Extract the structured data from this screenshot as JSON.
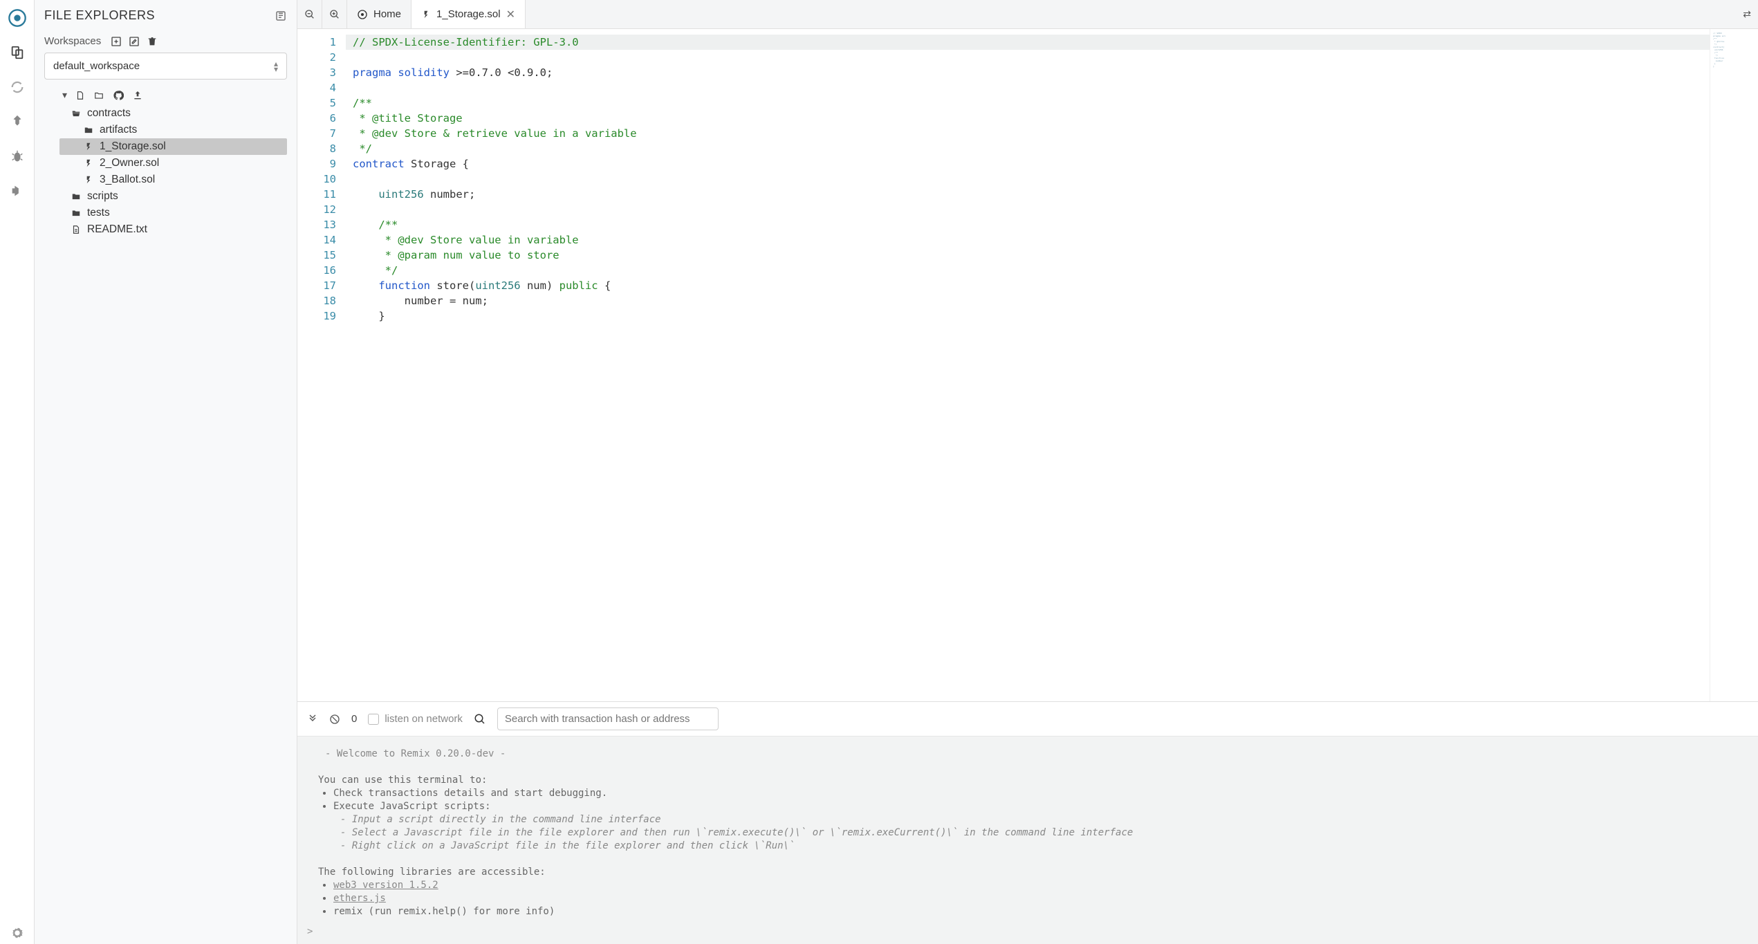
{
  "sidebar": {
    "title": "FILE EXPLORERS",
    "workspaces_label": "Workspaces",
    "selected_workspace": "default_workspace",
    "tree": [
      {
        "name": "contracts",
        "type": "folder-open",
        "depth": 0
      },
      {
        "name": "artifacts",
        "type": "folder",
        "depth": 1
      },
      {
        "name": "1_Storage.sol",
        "type": "sol",
        "depth": 1,
        "selected": true
      },
      {
        "name": "2_Owner.sol",
        "type": "sol",
        "depth": 1
      },
      {
        "name": "3_Ballot.sol",
        "type": "sol",
        "depth": 1
      },
      {
        "name": "scripts",
        "type": "folder",
        "depth": 0
      },
      {
        "name": "tests",
        "type": "folder",
        "depth": 0
      },
      {
        "name": "README.txt",
        "type": "file",
        "depth": 0
      }
    ]
  },
  "tabs": {
    "home": "Home",
    "items": [
      {
        "label": "1_Storage.sol",
        "icon": "sol",
        "active": true,
        "closable": true
      }
    ]
  },
  "editor": {
    "lines": [
      {
        "n": 1,
        "hl": true,
        "html": "<span class='c-comment'>// SPDX-License-Identifier: GPL-3.0</span>"
      },
      {
        "n": 2,
        "html": ""
      },
      {
        "n": 3,
        "html": "<span class='c-kw'>pragma</span> <span class='c-kw'>solidity</span> &gt;=0.7.0 &lt;0.9.0;"
      },
      {
        "n": 4,
        "html": ""
      },
      {
        "n": 5,
        "html": "<span class='c-comment'>/**</span>"
      },
      {
        "n": 6,
        "html": "<span class='c-comment'> * @title Storage</span>"
      },
      {
        "n": 7,
        "html": "<span class='c-comment'> * @dev Store &amp; retrieve value in a variable</span>"
      },
      {
        "n": 8,
        "html": "<span class='c-comment'> */</span>"
      },
      {
        "n": 9,
        "html": "<span class='c-kw'>contract</span> Storage {"
      },
      {
        "n": 10,
        "html": ""
      },
      {
        "n": 11,
        "html": "    <span class='c-type'>uint256</span> number;"
      },
      {
        "n": 12,
        "html": ""
      },
      {
        "n": 13,
        "html": "    <span class='c-comment'>/**</span>"
      },
      {
        "n": 14,
        "html": "    <span class='c-comment'> * @dev Store value in variable</span>"
      },
      {
        "n": 15,
        "html": "    <span class='c-comment'> * @param num value to store</span>"
      },
      {
        "n": 16,
        "html": "    <span class='c-comment'> */</span>"
      },
      {
        "n": 17,
        "html": "    <span class='c-kw'>function</span> store(<span class='c-type'>uint256</span> num) <span class='c-mod'>public</span> {"
      },
      {
        "n": 18,
        "html": "        number = num;"
      },
      {
        "n": 19,
        "html": "    }"
      }
    ]
  },
  "terminal": {
    "count": "0",
    "listen_label": "listen on network",
    "search_placeholder": "Search with transaction hash or address",
    "welcome": " - Welcome to Remix 0.20.0-dev - ",
    "intro": "You can use this terminal to:",
    "bullets": [
      "Check transactions details and start debugging.",
      "Execute JavaScript scripts:"
    ],
    "script_hints": [
      "- Input a script directly in the command line interface",
      "- Select a Javascript file in the file explorer and then run \\`remix.execute()\\` or \\`remix.exeCurrent()\\`  in the command line interface",
      "- Right click on a JavaScript file in the file explorer and then click \\`Run\\`"
    ],
    "libs_intro": "The following libraries are accessible:",
    "libs": [
      {
        "label": "web3 version 1.5.2",
        "link": true
      },
      {
        "label": "ethers.js",
        "link": true
      },
      {
        "label": "remix (run remix.help() for more info)",
        "link": false
      }
    ],
    "prompt": ">"
  }
}
